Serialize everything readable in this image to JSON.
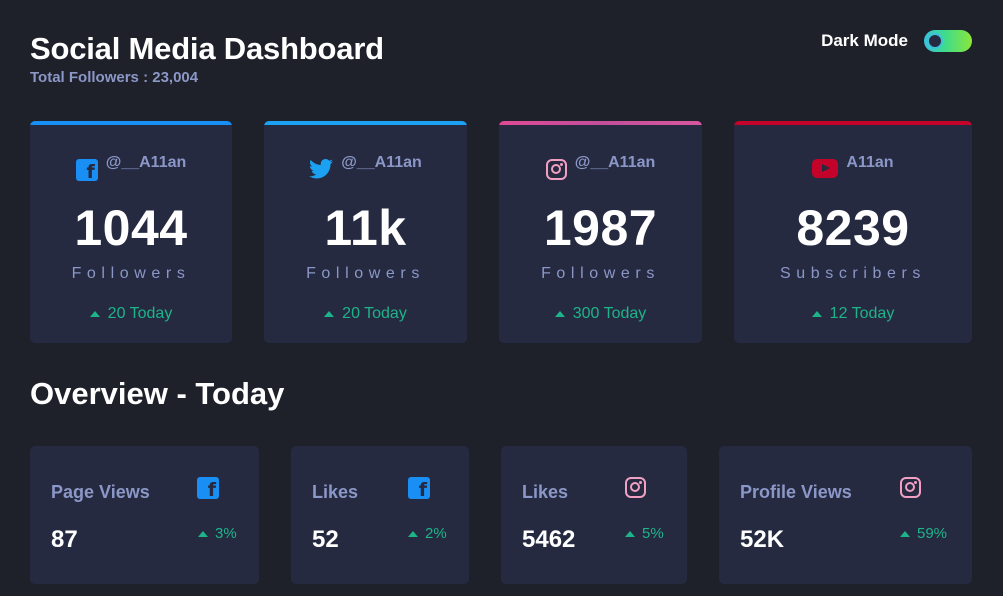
{
  "header": {
    "title": "Social Media Dashboard",
    "subtitle": "Total Followers : 23,004",
    "toggle_label": "Dark Mode",
    "toggle_on": true
  },
  "cards": [
    {
      "platform": "facebook",
      "icon": "facebook-icon",
      "handle": "@__A11an",
      "count": "1044",
      "unit": "Followers",
      "today": "20 Today",
      "accent": "#178ff5"
    },
    {
      "platform": "twitter",
      "icon": "twitter-icon",
      "handle": "@__A11an",
      "count": "11k",
      "unit": "Followers",
      "today": "20 Today",
      "accent": "#1ca0f2"
    },
    {
      "platform": "instagram",
      "icon": "instagram-icon",
      "handle": "@__A11an",
      "count": "1987",
      "unit": "Followers",
      "today": "300 Today",
      "accent": "#df4996"
    },
    {
      "platform": "youtube",
      "icon": "youtube-icon",
      "handle": "A11an",
      "count": "8239",
      "unit": "Subscribers",
      "today": "12 Today",
      "accent": "#c4032a"
    }
  ],
  "overview": {
    "title": "Overview - Today",
    "items": [
      {
        "label": "Page Views",
        "icon": "facebook-icon",
        "value": "87",
        "change": "3%"
      },
      {
        "label": "Likes",
        "icon": "facebook-icon",
        "value": "52",
        "change": "2%"
      },
      {
        "label": "Likes",
        "icon": "instagram-icon",
        "value": "5462",
        "change": "5%"
      },
      {
        "label": "Profile Views",
        "icon": "instagram-icon",
        "value": "52K",
        "change": "59%"
      }
    ]
  },
  "colors": {
    "background": "#1e202a",
    "card": "#252a41",
    "muted_text": "#8b97c6",
    "positive": "#1db489"
  }
}
